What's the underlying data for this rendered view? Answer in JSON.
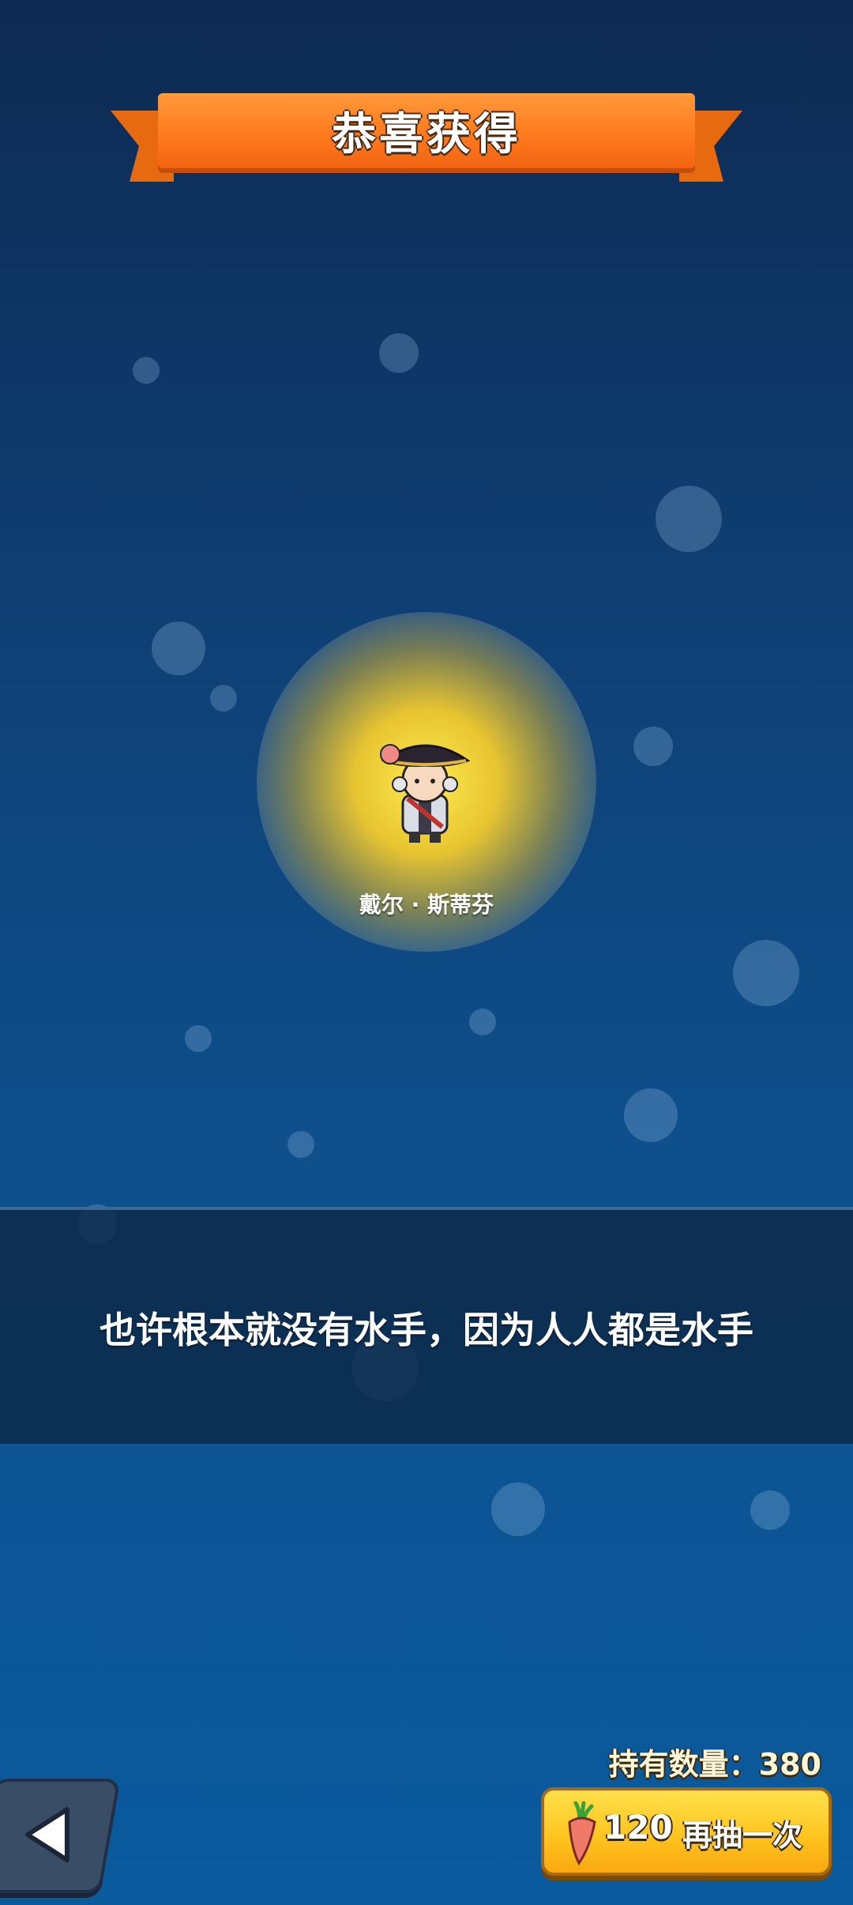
{
  "banner": {
    "title": "恭喜获得"
  },
  "reward": {
    "character_name": "戴尔 · 斯蒂芬",
    "character_icon": "pirate-character-icon"
  },
  "quote": {
    "text": "也许根本就没有水手，因为人人都是水手"
  },
  "footer": {
    "hold_label": "持有数量：380",
    "draw_cost": "120",
    "draw_label": "再抽一次",
    "cost_icon": "carrot-icon",
    "back_icon": "back-arrow-icon"
  },
  "colors": {
    "banner": "#ff7a1e",
    "button": "#ffc21e",
    "background": "#0e4f8c"
  }
}
